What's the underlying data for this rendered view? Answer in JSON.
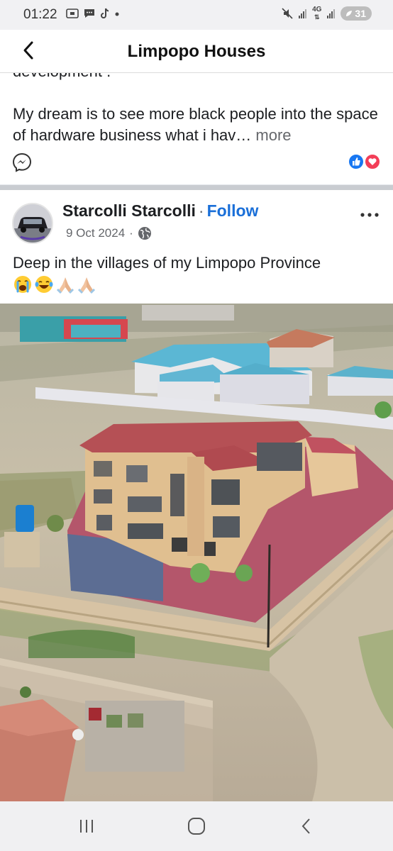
{
  "status_bar": {
    "time": "01:22",
    "network_type": "4G",
    "battery": "31"
  },
  "header": {
    "title": "Limpopo Houses"
  },
  "prev_post": {
    "cut_text": "development .",
    "text": "My dream is to see more black people into the space of hardware business what i hav…",
    "more_label": "more"
  },
  "post": {
    "author": "Starcolli Starcolli",
    "separator": "·",
    "follow_label": "Follow",
    "date": "9 Oct 2024",
    "text": "Deep in the villages of my Limpopo Province",
    "emojis": [
      "loudly-crying-face",
      "face-with-tears-of-joy",
      "folded-hands",
      "folded-hands"
    ],
    "image_description_icon": "aerial-house-photo"
  },
  "nav": {
    "recent_icon": "recent-apps-icon",
    "home_icon": "home-icon",
    "back_icon": "back-icon"
  },
  "colors": {
    "accent": "#1a6fd8",
    "like_blue": "#1877f2",
    "love_red": "#f33e58"
  }
}
